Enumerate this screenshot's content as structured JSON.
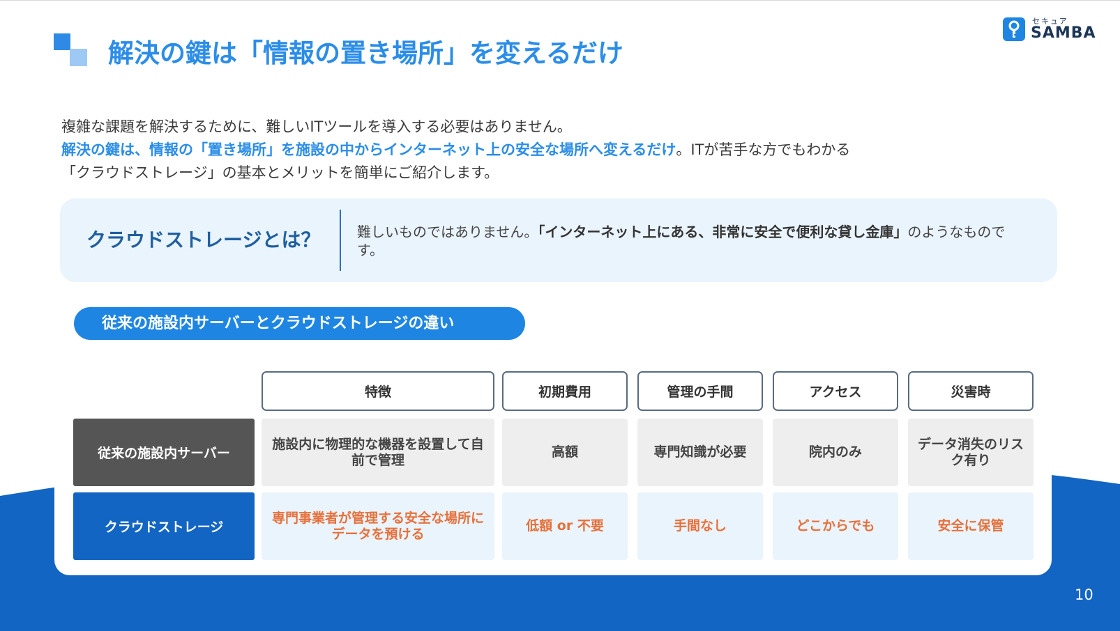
{
  "header": {
    "title": "解決の鍵は「情報の置き場所」を変えるだけ",
    "logo": {
      "kana": "セキュア",
      "name": "SAMBA"
    }
  },
  "intro": {
    "line1": "複雑な課題を解決するために、難しいITツールを導入する必要はありません。",
    "line2_highlight": "解決の鍵は、情報の「置き場所」を施設の中からインターネット上の安全な場所へ変えるだけ",
    "line2_rest": "。ITが苦手な方でもわかる",
    "line3": "「クラウドストレージ」の基本とメリットを簡単にご紹介します。"
  },
  "definition": {
    "term": "クラウドストレージとは？",
    "desc_pre": "難しいものではありません。",
    "desc_strong": "「インターネット上にある、非常に安全で便利な貸し金庫」",
    "desc_post": "のようなものです。"
  },
  "comparison": {
    "title": "従来の施設内サーバーとクラウドストレージの違い",
    "columns": [
      "特徴",
      "初期費用",
      "管理の手間",
      "アクセス",
      "災害時"
    ],
    "rows": [
      {
        "label": "従来の施設内サーバー",
        "cells": [
          "施設内に物理的な機器を設置して自前で管理",
          "高額",
          "専門知識が必要",
          "院内のみ",
          "データ消失のリスク有り"
        ]
      },
      {
        "label": "クラウドストレージ",
        "cells": [
          "専門事業者が管理する安全な場所にデータを預ける",
          "低額 or 不要",
          "手間なし",
          "どこからでも",
          "安全に保管"
        ]
      }
    ]
  },
  "footer": {
    "page_number": "10"
  },
  "colors": {
    "accent": "#2b8de8",
    "navy": "#1265c2",
    "orange": "#e8703a",
    "dark_gray": "#555555"
  }
}
